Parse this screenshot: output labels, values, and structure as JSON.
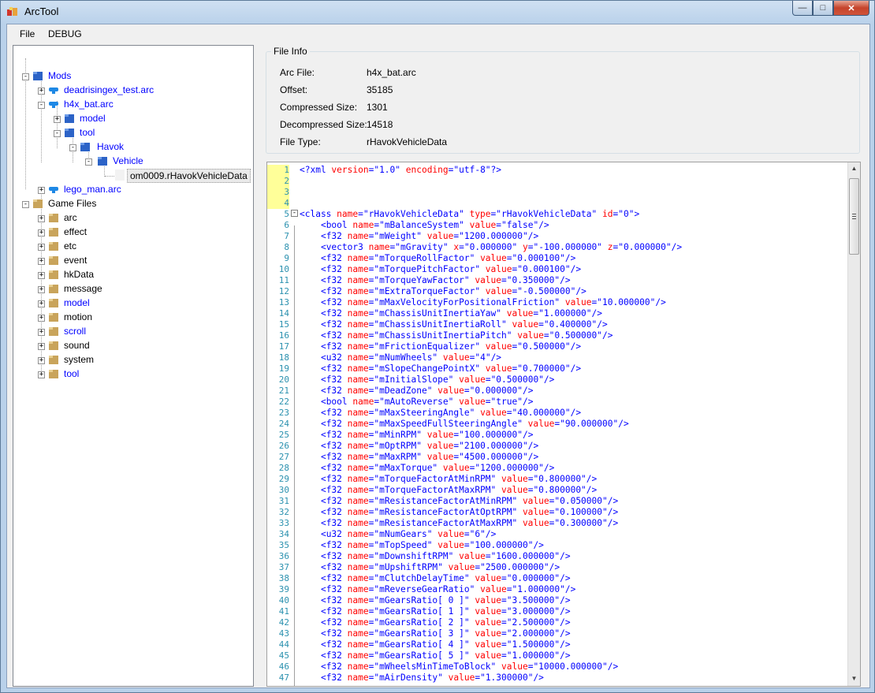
{
  "window": {
    "title": "ArcTool"
  },
  "menu": {
    "file": "File",
    "debug": "DEBUG"
  },
  "tree": {
    "mods": "Mods",
    "deadrising": "deadrisingex_test.arc",
    "h4x": "h4x_bat.arc",
    "model": "model",
    "tool": "tool",
    "havok": "Havok",
    "vehicle": "Vehicle",
    "om": "om0009.rHavokVehicleData",
    "lego": "lego_man.arc",
    "game_files": "Game Files",
    "game_items": [
      "arc",
      "effect",
      "etc",
      "event",
      "hkData",
      "message",
      "model",
      "motion",
      "scroll",
      "sound",
      "system",
      "tool"
    ]
  },
  "file_info": {
    "title": "File Info",
    "rows": [
      {
        "label": "Arc File:",
        "value": "h4x_bat.arc"
      },
      {
        "label": "Offset:",
        "value": "35185"
      },
      {
        "label": "Compressed Size:",
        "value": "1301"
      },
      {
        "label": "Decompressed Size:",
        "value": "14518"
      },
      {
        "label": "File Type:",
        "value": "rHavokVehicleData"
      }
    ]
  },
  "editor": {
    "lines": [
      "<?xml version=\"1.0\" encoding=\"utf-8\"?>",
      "",
      "",
      "",
      "<class name=\"rHavokVehicleData\" type=\"rHavokVehicleData\" id=\"0\">",
      "    <bool name=\"mBalanceSystem\" value=\"false\"/>",
      "    <f32 name=\"mWeight\" value=\"1200.000000\"/>",
      "    <vector3 name=\"mGravity\" x=\"0.000000\" y=\"-100.000000\" z=\"0.000000\"/>",
      "    <f32 name=\"mTorqueRollFactor\" value=\"0.000100\"/>",
      "    <f32 name=\"mTorquePitchFactor\" value=\"0.000100\"/>",
      "    <f32 name=\"mTorqueYawFactor\" value=\"0.350000\"/>",
      "    <f32 name=\"mExtraTorqueFactor\" value=\"-0.500000\"/>",
      "    <f32 name=\"mMaxVelocityForPositionalFriction\" value=\"10.000000\"/>",
      "    <f32 name=\"mChassisUnitInertiaYaw\" value=\"1.000000\"/>",
      "    <f32 name=\"mChassisUnitInertiaRoll\" value=\"0.400000\"/>",
      "    <f32 name=\"mChassisUnitInertiaPitch\" value=\"0.500000\"/>",
      "    <f32 name=\"mFrictionEqualizer\" value=\"0.500000\"/>",
      "    <u32 name=\"mNumWheels\" value=\"4\"/>",
      "    <f32 name=\"mSlopeChangePointX\" value=\"0.700000\"/>",
      "    <f32 name=\"mInitialSlope\" value=\"0.500000\"/>",
      "    <f32 name=\"mDeadZone\" value=\"0.000000\"/>",
      "    <bool name=\"mAutoReverse\" value=\"true\"/>",
      "    <f32 name=\"mMaxSteeringAngle\" value=\"40.000000\"/>",
      "    <f32 name=\"mMaxSpeedFullSteeringAngle\" value=\"90.000000\"/>",
      "    <f32 name=\"mMinRPM\" value=\"100.000000\"/>",
      "    <f32 name=\"mOptRPM\" value=\"2100.000000\"/>",
      "    <f32 name=\"mMaxRPM\" value=\"4500.000000\"/>",
      "    <f32 name=\"mMaxTorque\" value=\"1200.000000\"/>",
      "    <f32 name=\"mTorqueFactorAtMinRPM\" value=\"0.800000\"/>",
      "    <f32 name=\"mTorqueFactorAtMaxRPM\" value=\"0.800000\"/>",
      "    <f32 name=\"mResistanceFactorAtMinRPM\" value=\"0.050000\"/>",
      "    <f32 name=\"mResistanceFactorAtOptRPM\" value=\"0.100000\"/>",
      "    <f32 name=\"mResistanceFactorAtMaxRPM\" value=\"0.300000\"/>",
      "    <u32 name=\"mNumGears\" value=\"6\"/>",
      "    <f32 name=\"mTopSpeed\" value=\"100.000000\"/>",
      "    <f32 name=\"mDownshiftRPM\" value=\"1600.000000\"/>",
      "    <f32 name=\"mUpshiftRPM\" value=\"2500.000000\"/>",
      "    <f32 name=\"mClutchDelayTime\" value=\"0.000000\"/>",
      "    <f32 name=\"mReverseGearRatio\" value=\"1.000000\"/>",
      "    <f32 name=\"mGearsRatio[ 0 ]\" value=\"3.500000\"/>",
      "    <f32 name=\"mGearsRatio[ 1 ]\" value=\"3.000000\"/>",
      "    <f32 name=\"mGearsRatio[ 2 ]\" value=\"2.500000\"/>",
      "    <f32 name=\"mGearsRatio[ 3 ]\" value=\"2.000000\"/>",
      "    <f32 name=\"mGearsRatio[ 4 ]\" value=\"1.500000\"/>",
      "    <f32 name=\"mGearsRatio[ 5 ]\" value=\"1.000000\"/>",
      "    <f32 name=\"mWheelsMinTimeToBlock\" value=\"10000.000000\"/>",
      "    <f32 name=\"mAirDensity\" value=\"1.300000\"/>"
    ]
  },
  "colors": {
    "tag": "#0000ff",
    "attr": "#ff0000",
    "value": "#0000ff",
    "line_number": "#2b91af",
    "changed_line": "#ffff99"
  }
}
